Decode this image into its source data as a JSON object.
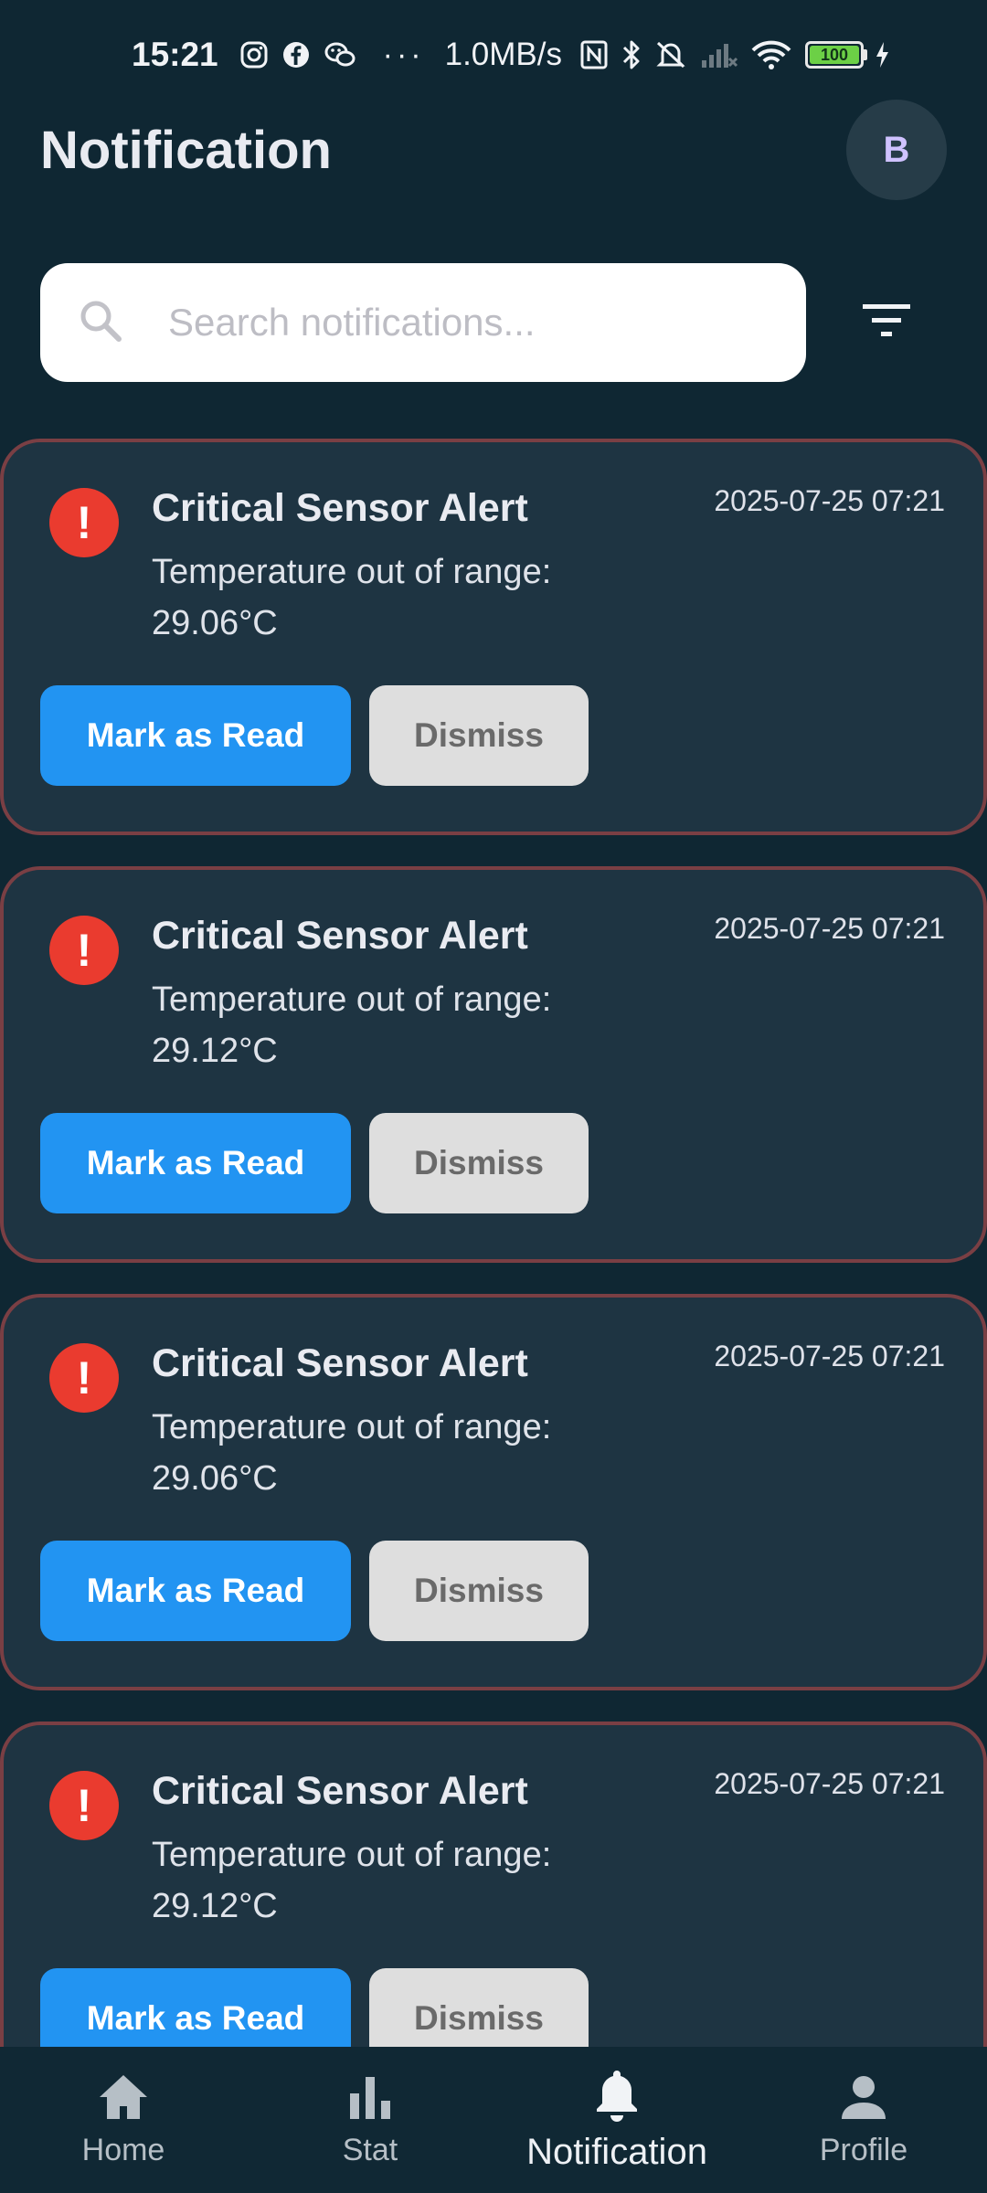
{
  "status_bar": {
    "time": "15:21",
    "net_speed": "1.0MB/s",
    "dots": "···",
    "battery_level": "100",
    "icons": [
      "instagram-icon",
      "facebook-icon",
      "wechat-icon",
      "nfc-icon",
      "bluetooth-icon",
      "mute-icon",
      "signal-icon",
      "wifi-icon",
      "battery-icon",
      "charging-icon"
    ]
  },
  "header": {
    "title": "Notification",
    "avatar_initial": "B"
  },
  "search": {
    "placeholder": "Search notifications..."
  },
  "notifications": [
    {
      "title": "Critical Sensor Alert",
      "message": "Temperature out of range: 29.06°C",
      "time": "2025-07-25 07:21",
      "mark_label": "Mark as Read",
      "dismiss_label": "Dismiss"
    },
    {
      "title": "Critical Sensor Alert",
      "message": "Temperature out of range: 29.12°C",
      "time": "2025-07-25 07:21",
      "mark_label": "Mark as Read",
      "dismiss_label": "Dismiss"
    },
    {
      "title": "Critical Sensor Alert",
      "message": "Temperature out of range: 29.06°C",
      "time": "2025-07-25 07:21",
      "mark_label": "Mark as Read",
      "dismiss_label": "Dismiss"
    },
    {
      "title": "Critical Sensor Alert",
      "message": "Temperature out of range: 29.12°C",
      "time": "2025-07-25 07:21",
      "mark_label": "Mark as Read",
      "dismiss_label": "Dismiss"
    }
  ],
  "bottom_nav": [
    {
      "label": "Home",
      "icon": "home-icon"
    },
    {
      "label": "Stat",
      "icon": "bar-chart-icon"
    },
    {
      "label": "Notification",
      "icon": "bell-icon",
      "active": true
    },
    {
      "label": "Profile",
      "icon": "person-icon"
    }
  ],
  "colors": {
    "background": "#0f2733",
    "card": "#1e3442",
    "card_border": "#7a3f44",
    "alert": "#ea3b2f",
    "primary": "#2294f2"
  }
}
